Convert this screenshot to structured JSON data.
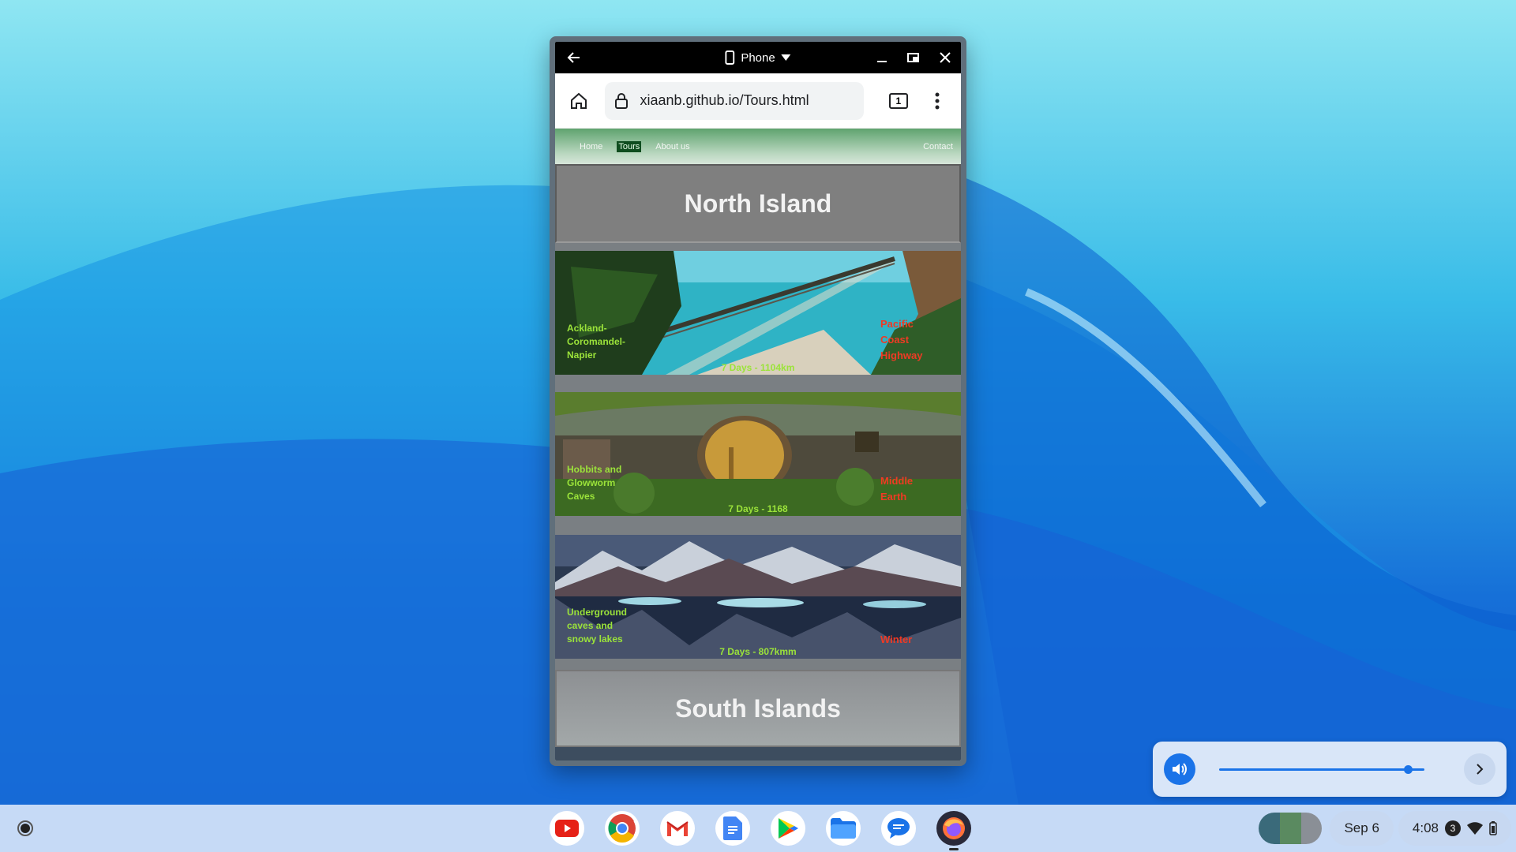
{
  "window": {
    "device_label": "Phone",
    "url": "xiaanb.github.io/Tours.html",
    "tab_count": "1"
  },
  "site": {
    "nav": {
      "home": "Home",
      "tours": "Tours",
      "about": "About us",
      "contact": "Contact"
    },
    "north_heading": "North Island",
    "south_heading": "South Islands",
    "tours": [
      {
        "left": "Ackland-Coromandel-Napier",
        "right": "Pacific Coast Highway",
        "meta": "7 Days - 1104km"
      },
      {
        "left": "Hobbits and Glowworm Caves",
        "right": "Middle Earth",
        "meta": "7 Days - 1168"
      },
      {
        "left": "Underground caves and snowy lakes",
        "right": "Winter",
        "meta": "7 Days - 807kmm"
      }
    ]
  },
  "volume": {
    "level": 0.94
  },
  "shelf": {
    "apps": [
      "youtube-icon",
      "chrome-icon",
      "gmail-icon",
      "docs-icon",
      "play-store-icon",
      "files-icon",
      "messages-icon",
      "firefox-icon"
    ],
    "date": "Sep 6",
    "time": "4:08",
    "notification_count": "3"
  }
}
